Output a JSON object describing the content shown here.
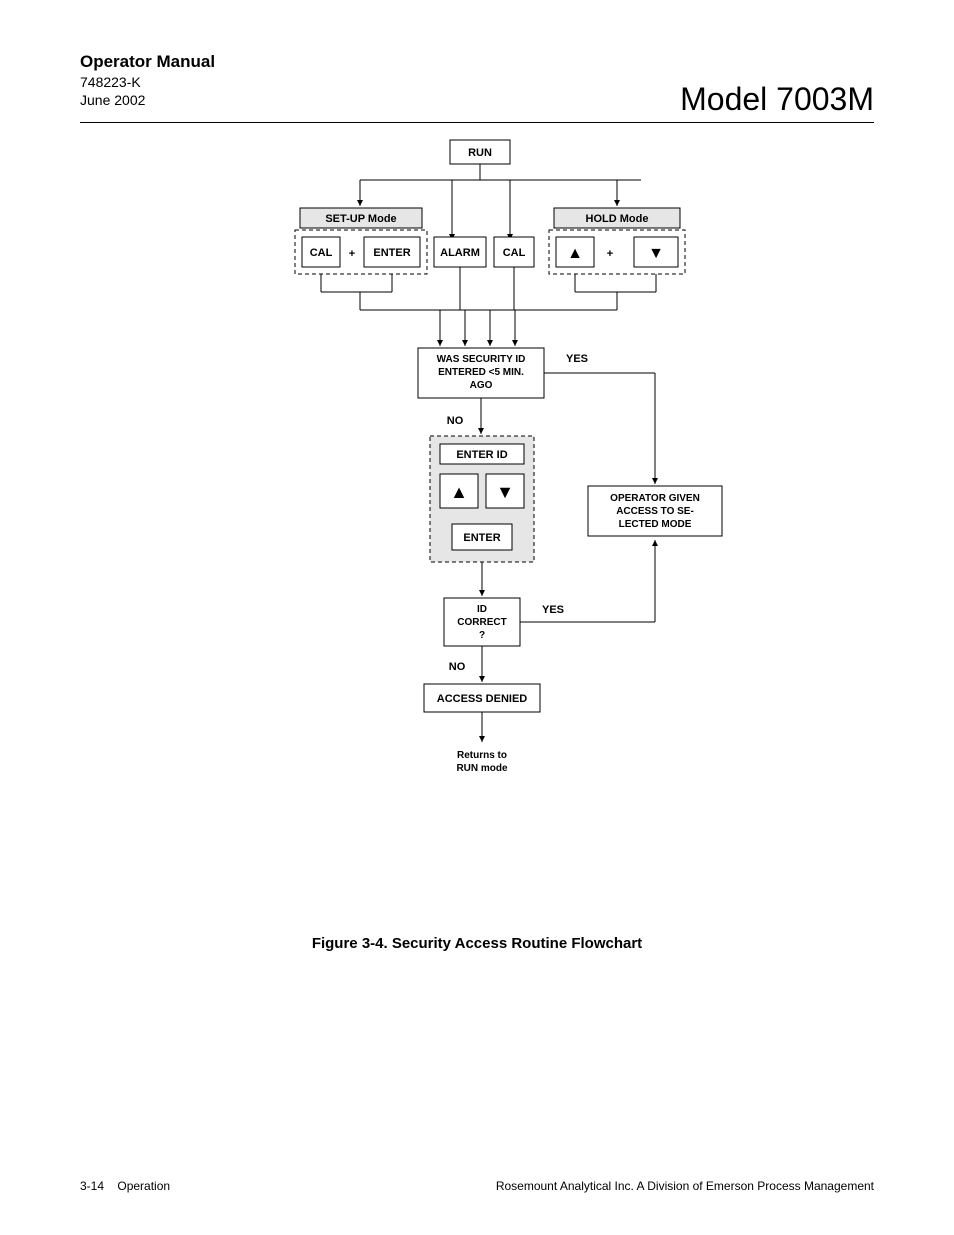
{
  "header": {
    "title": "Operator Manual",
    "doc_number": "748223-K",
    "date": "June 2002",
    "model": "Model 7003M"
  },
  "flow": {
    "run": "RUN",
    "setup_mode": "SET-UP Mode",
    "hold_mode": "HOLD Mode",
    "cal": "CAL",
    "plus": "+",
    "enter": "ENTER",
    "alarm": "ALARM",
    "up": "▲",
    "down": "▼",
    "q_security_l1": "WAS SECURITY ID",
    "q_security_l2": "ENTERED <5 MIN.",
    "q_security_l3": "AGO",
    "yes": "YES",
    "no": "NO",
    "enter_id": "ENTER ID",
    "access_l1": "OPERATOR GIVEN",
    "access_l2": "ACCESS TO SE-",
    "access_l3": "LECTED MODE",
    "id_correct_l1": "ID",
    "id_correct_l2": "CORRECT",
    "id_correct_l3": "?",
    "access_denied": "ACCESS DENIED",
    "returns_l1": "Returns to",
    "returns_l2": "RUN mode"
  },
  "caption": "Figure 3-4.  Security Access Routine Flowchart",
  "footer": {
    "left_page": "3-14",
    "left_section": "Operation",
    "right": "Rosemount Analytical Inc.    A Division of Emerson Process Management"
  }
}
